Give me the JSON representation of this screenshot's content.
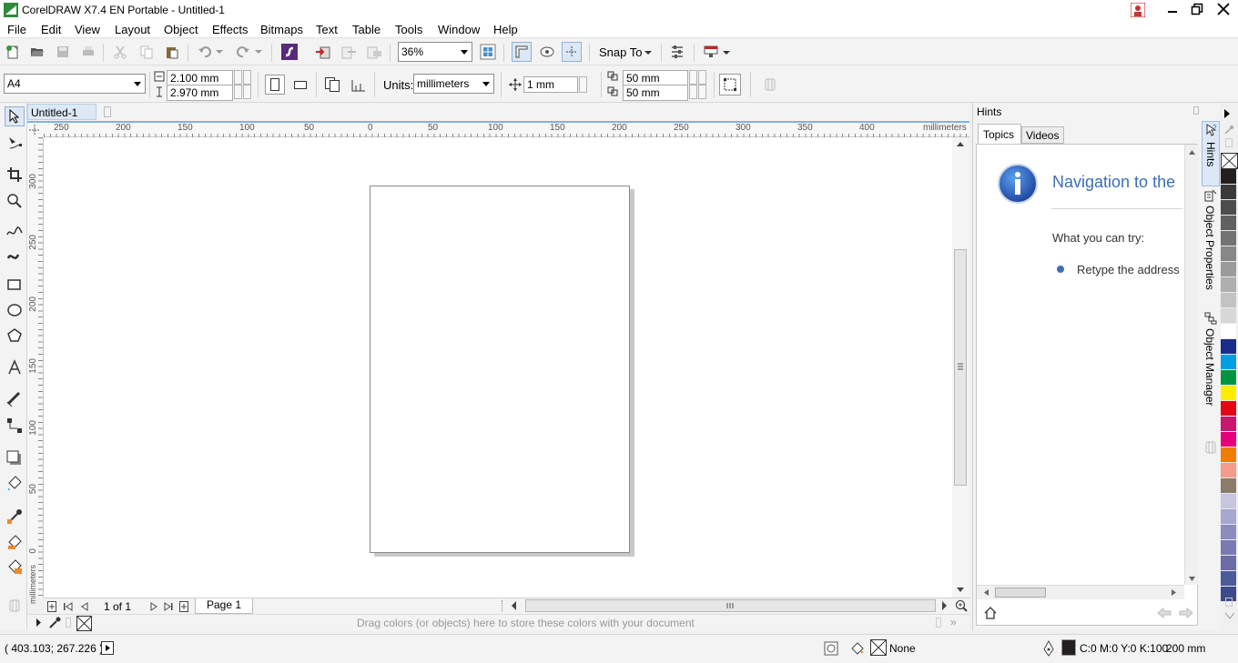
{
  "window": {
    "title": "CorelDRAW X7.4 EN Portable - Untitled-1"
  },
  "menu": [
    "File",
    "Edit",
    "View",
    "Layout",
    "Object",
    "Effects",
    "Bitmaps",
    "Text",
    "Table",
    "Tools",
    "Window",
    "Help"
  ],
  "standard_toolbar": {
    "zoom": "36%",
    "snap_to": "Snap To"
  },
  "property_bar": {
    "page_size": "A4",
    "width": "2.100 mm",
    "height": "2.970 mm",
    "units_label": "Units:",
    "units": "millimeters",
    "nudge": "1 mm",
    "dup_x": "50 mm",
    "dup_y": "50 mm"
  },
  "document_tab": "Untitled-1",
  "ruler": {
    "h_ticks": [
      "250",
      "200",
      "150",
      "100",
      "50",
      "0",
      "50",
      "100",
      "150",
      "200",
      "250",
      "300",
      "350",
      "400"
    ],
    "h_unit": "millimeters",
    "v_ticks": [
      "300",
      "250",
      "200",
      "150",
      "100",
      "50",
      "0"
    ],
    "v_unit": "millimeters"
  },
  "page_nav": {
    "counter": "1 of 1",
    "page_tab": "Page 1"
  },
  "palette_hint": "Drag colors (or objects) here to store these colors with your document",
  "status": {
    "coords": "( 403.103; 267.226 )",
    "fill": "None",
    "outline_color": "C:0 M:0 Y:0 K:100",
    "outline_width": "200 mm"
  },
  "hints_panel": {
    "title": "Hints",
    "tabs": [
      "Topics",
      "Videos"
    ],
    "heading": "Navigation to the",
    "subheading": "What you can try:",
    "bullet": "Retype the address"
  },
  "side_tabs": [
    "Hints",
    "Object Properties",
    "Object Manager"
  ],
  "palette_colors": [
    "#231f20",
    "#3a3a3a",
    "#4d4d4d",
    "#606060",
    "#737373",
    "#878787",
    "#9b9b9b",
    "#afafaf",
    "#c3c3c3",
    "#d7d7d7",
    "#ffffff",
    "#1c2c8c",
    "#009fe3",
    "#00963f",
    "#ffed00",
    "#e30613",
    "#c8176f",
    "#e6007e",
    "#ef7d00",
    "#f39c8c",
    "#8c7b6b",
    "#c6c6e0",
    "#a6a6d0",
    "#8c8cc0",
    "#7a7ab3",
    "#6b6ba8",
    "#4a5a9a",
    "#3b4a8a"
  ],
  "colors": {
    "accent": "#3b7dc9",
    "ruler_highlight": "#7fb3e0"
  }
}
